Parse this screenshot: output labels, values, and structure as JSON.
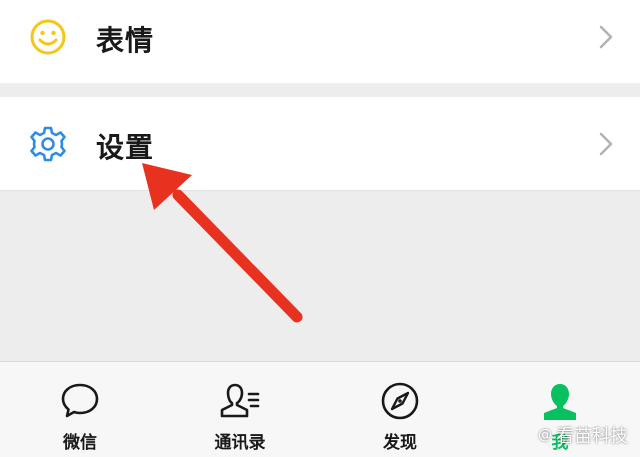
{
  "menu": {
    "emoji_row": {
      "label": "表情",
      "icon": "smiley-icon"
    },
    "settings_row": {
      "label": "设置",
      "icon": "gear-icon"
    }
  },
  "tabbar": {
    "tabs": [
      {
        "label": "微信",
        "icon": "chat-bubble-icon"
      },
      {
        "label": "通讯录",
        "icon": "contacts-icon"
      },
      {
        "label": "发现",
        "icon": "compass-icon"
      },
      {
        "label": "我",
        "icon": "person-icon"
      }
    ],
    "active_color": "#07c160"
  },
  "watermark": {
    "logo": "@",
    "text": "看苗科技"
  },
  "colors": {
    "arrow": "#e8321f",
    "emoji_icon": "#f5c518",
    "settings_icon": "#2f8ce5",
    "chevron": "#b3b3b3"
  }
}
